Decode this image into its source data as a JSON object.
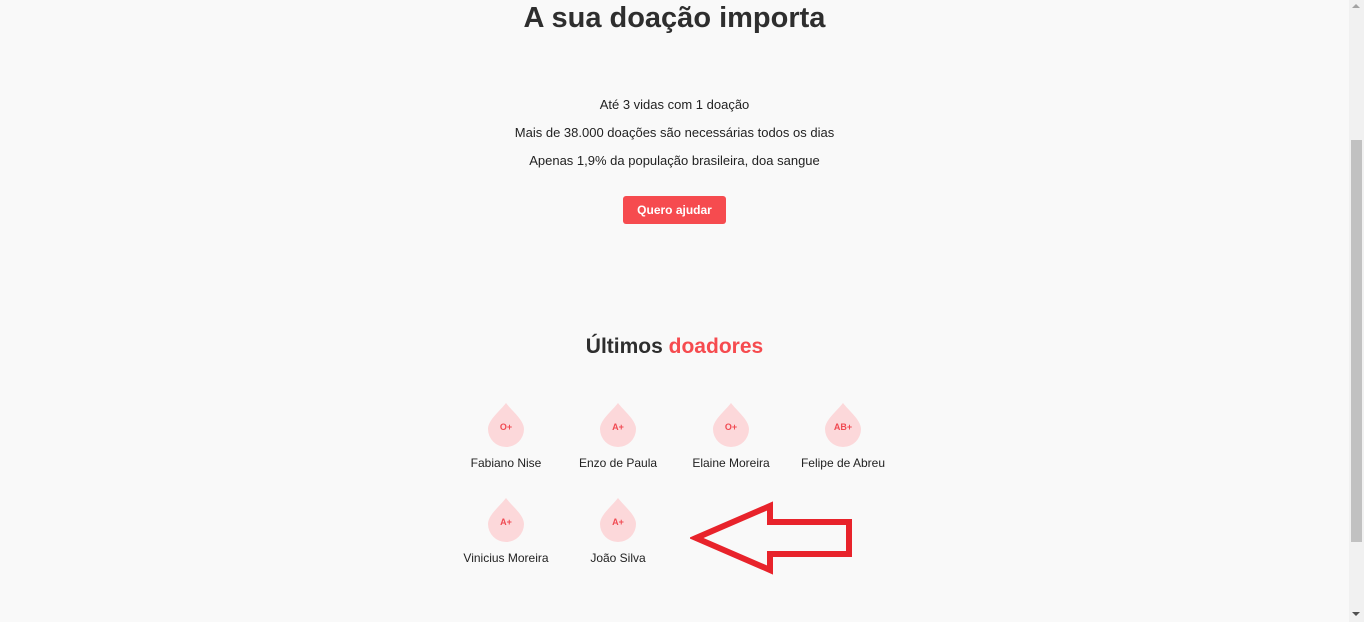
{
  "hero": {
    "title": "A sua doação importa",
    "facts": [
      "Até 3 vidas com 1 doação",
      "Mais de 38.000 doações são necessárias todos os dias",
      "Apenas 1,9% da população brasileira, doa sangue"
    ],
    "cta_label": "Quero ajudar"
  },
  "donors": {
    "title_prefix": "Últimos",
    "title_accent": "doadores",
    "list": [
      {
        "name": "Fabiano Nise",
        "blood_type": "O+"
      },
      {
        "name": "Enzo de Paula",
        "blood_type": "A+"
      },
      {
        "name": "Elaine Moreira",
        "blood_type": "O+"
      },
      {
        "name": "Felipe de Abreu",
        "blood_type": "AB+"
      },
      {
        "name": "Vinicius Moreira",
        "blood_type": "A+"
      },
      {
        "name": "João Silva",
        "blood_type": "A+"
      }
    ]
  },
  "colors": {
    "accent": "#f64b4f",
    "drop_fill": "#fcd8da",
    "annotation_arrow": "#e8232b"
  },
  "icons": {
    "drop": "blood-drop-icon",
    "annotation": "left-arrow-annotation-icon"
  }
}
